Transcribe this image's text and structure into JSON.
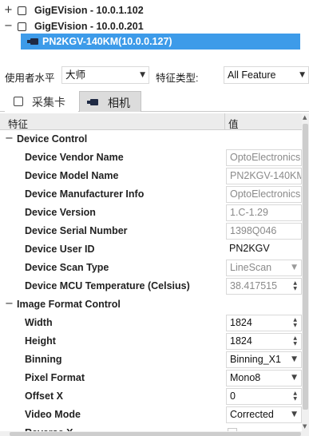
{
  "device_tree": {
    "nodes": [
      {
        "expander": "+",
        "label": "GigEVision - 10.0.1.102"
      },
      {
        "expander": "−",
        "label": "GigEVision - 10.0.0.201"
      }
    ],
    "selected_camera": {
      "label": "PN2KGV-140KM(10.0.0.127)",
      "icon": "camera-icon"
    }
  },
  "filter": {
    "user_level_label": "使用者水平",
    "user_level_value": "大师",
    "feature_type_label": "特征类型:",
    "feature_type_value": "All Feature"
  },
  "tabs": [
    {
      "label": "采集卡",
      "icon": "checkbox-icon"
    },
    {
      "label": "相机",
      "icon": "camera-icon"
    }
  ],
  "grid": {
    "headers": {
      "feature": "特征",
      "value": "值"
    },
    "categories": [
      {
        "name": "Device Control",
        "expander": "−",
        "rows": [
          {
            "name": "Device Vendor Name",
            "value": "OptoElectronics",
            "kind": "text",
            "readonly": true
          },
          {
            "name": "Device Model Name",
            "value": "PN2KGV-140KM",
            "kind": "text",
            "readonly": true
          },
          {
            "name": "Device Manufacturer Info",
            "value": "OptoElectronics",
            "kind": "text",
            "readonly": true
          },
          {
            "name": "Device Version",
            "value": "1.C-1.29",
            "kind": "text",
            "readonly": true
          },
          {
            "name": "Device Serial Number",
            "value": "1398Q046",
            "kind": "text",
            "readonly": true
          },
          {
            "name": "Device User ID",
            "value": "PN2KGV",
            "kind": "text",
            "readonly": false
          },
          {
            "name": "Device Scan Type",
            "value": "LineScan",
            "kind": "combo",
            "readonly": true
          },
          {
            "name": "Device MCU Temperature (Celsius)",
            "value": "38.417515",
            "kind": "spin",
            "readonly": true
          }
        ]
      },
      {
        "name": "Image Format Control",
        "expander": "−",
        "rows": [
          {
            "name": "Width",
            "value": "1824",
            "kind": "spin",
            "readonly": false
          },
          {
            "name": "Height",
            "value": "1824",
            "kind": "spin",
            "readonly": false
          },
          {
            "name": "Binning",
            "value": "Binning_X1",
            "kind": "combo",
            "readonly": false
          },
          {
            "name": "Pixel Format",
            "value": "Mono8",
            "kind": "combo",
            "readonly": false
          },
          {
            "name": "Offset X",
            "value": "0",
            "kind": "spin",
            "readonly": false
          },
          {
            "name": "Video Mode",
            "value": "Corrected",
            "kind": "combo",
            "readonly": false
          },
          {
            "name": "Reverse X",
            "value": "",
            "kind": "checkbox",
            "readonly": true
          }
        ]
      }
    ]
  }
}
